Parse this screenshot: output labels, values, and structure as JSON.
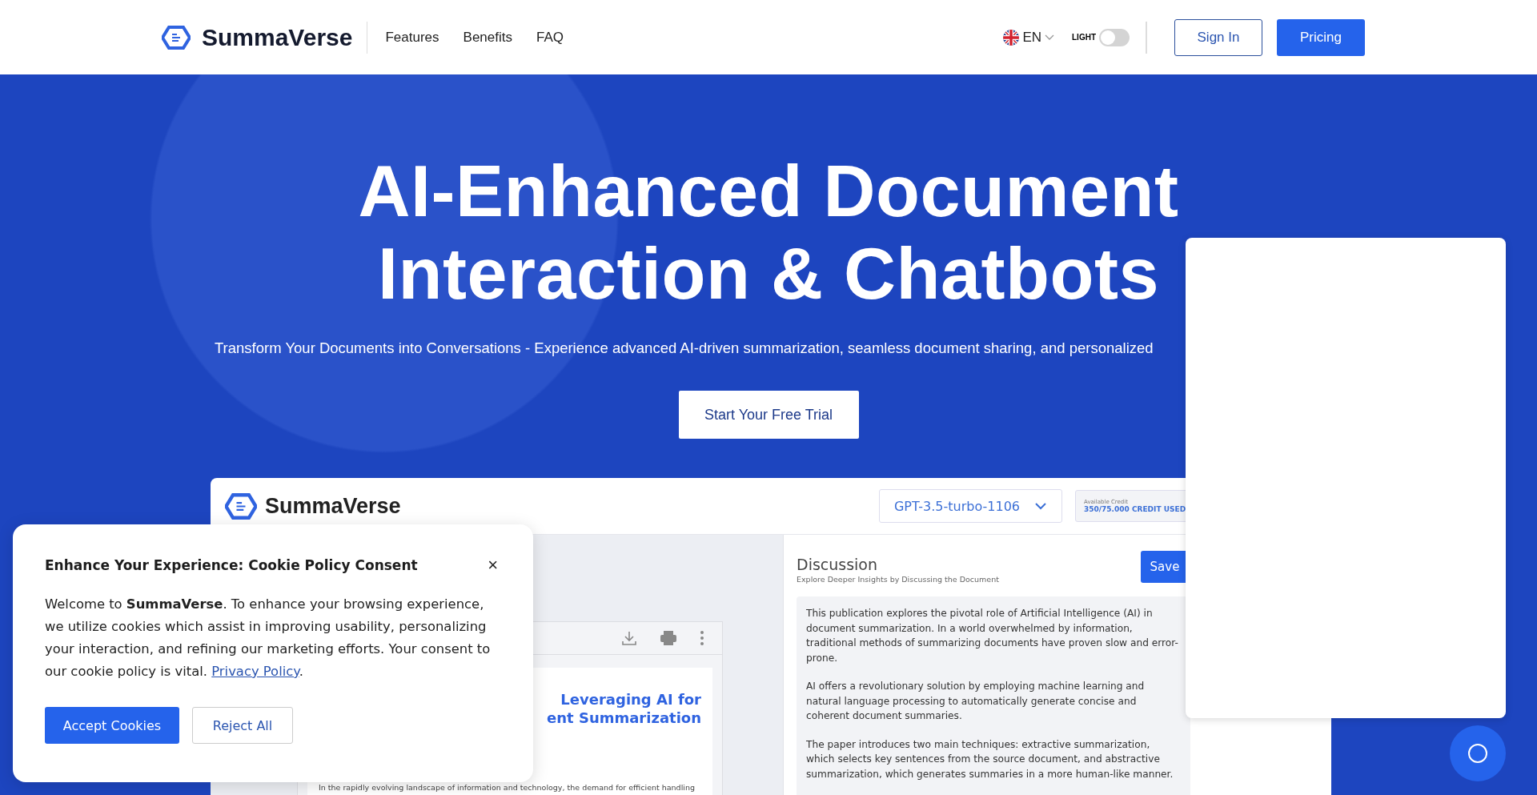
{
  "header": {
    "brand": "SummaVerse",
    "nav": [
      "Features",
      "Benefits",
      "FAQ"
    ],
    "language": "EN",
    "theme_toggle": {
      "label": "LIGHT",
      "on": false
    },
    "buttons": [
      {
        "label": "Sign In",
        "kind": "outline"
      },
      {
        "label": "Pricing",
        "kind": "primary"
      }
    ]
  },
  "hero": {
    "title_lines": [
      "AI-Enhanced Document",
      "Interaction & Chatbots"
    ],
    "subtitle": "Transform Your Documents into Conversations - Experience advanced AI-driven summarization, seamless document sharing, and personalized",
    "cta": "Start Your Free Trial"
  },
  "app_preview": {
    "brand": "SummaVerse",
    "model": "GPT-3.5-turbo-1106",
    "credit_label": "Available Credit",
    "credit_value": "350/75.000 CREDIT USED",
    "document": {
      "title_lines": [
        "Leveraging AI for",
        "ent Summarization"
      ],
      "body": "In the rapidly evolving landscape of information and technology, the demand for efficient handling"
    },
    "discussion": {
      "title": "Discussion",
      "subtitle": "Explore Deeper Insights by Discussing the Document",
      "save": "Save",
      "paragraphs": [
        "This publication explores the pivotal role of Artificial Intelligence (AI) in document summarization. In a world overwhelmed by information, traditional methods of summarizing documents have proven slow and error-prone.",
        "AI offers a revolutionary solution by employing machine learning and natural language processing to automatically generate concise and coherent document summaries.",
        "The paper introduces two main techniques: extractive summarization, which selects key sentences from the source document, and abstractive summarization, which generates summaries in a more human-like manner."
      ]
    }
  },
  "cookie_dialog": {
    "title": "Enhance Your Experience: Cookie Policy Consent",
    "close": "×",
    "body": "Welcome to **SummaVerse**. To enhance your browsing experience, we utilize cookies which assist in improving usability, personalizing your interaction, and refining our marketing efforts. Your consent to our cookie policy is vital.",
    "link": "Privacy Policy",
    "after_link": ".",
    "buttons": [
      {
        "label": "Accept Cookies",
        "kind": "primary"
      },
      {
        "label": "Reject All",
        "kind": "outline"
      }
    ]
  }
}
